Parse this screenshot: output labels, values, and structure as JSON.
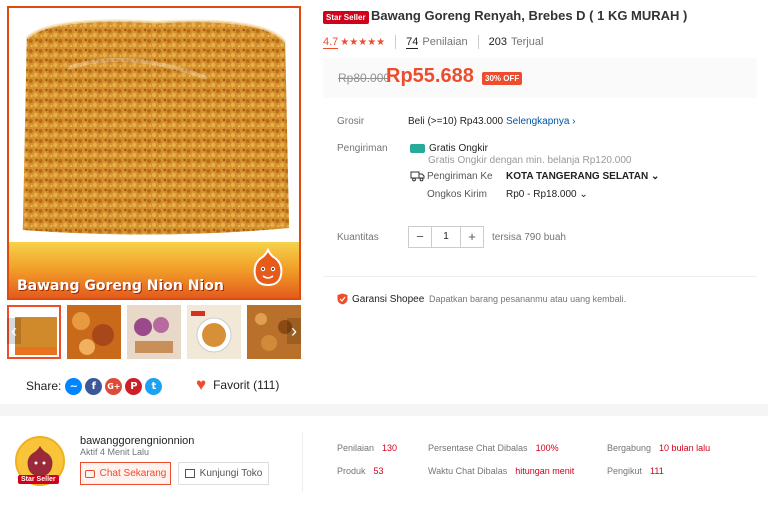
{
  "product": {
    "star_badge": "Star Seller",
    "title": "Bawang Goreng Renyah, Brebes D ( 1 KG MURAH )",
    "image_banner": "Bawang Goreng Nion Nion",
    "rating": "4.7",
    "stars": "★★★★★",
    "reviews_count": "74",
    "reviews_label": "Penilaian",
    "sold_count": "203",
    "sold_label": "Terjual",
    "old_price": "Rp80.000",
    "price": "Rp55.688",
    "discount": "30% OFF"
  },
  "details": {
    "grosir_label": "Grosir",
    "grosir_value": "Beli (>=10) Rp43.000",
    "grosir_link": "Selengkapnya ›",
    "shipping_label": "Pengiriman",
    "free_shipping": "Gratis Ongkir",
    "free_shipping_note": "Gratis Ongkir dengan min. belanja Rp120.000",
    "ship_to_label": "Pengiriman Ke",
    "ship_to_value": "KOTA TANGERANG SELATAN ⌄",
    "cost_label": "Ongkos Kirim",
    "cost_value": "Rp0 - Rp18.000 ⌄",
    "qty_label": "Kuantitas",
    "qty_minus": "−",
    "qty_value": "1",
    "qty_plus": "+",
    "stock": "tersisa 790 buah",
    "guarantee_title": "Garansi Shopee",
    "guarantee_desc": "Dapatkan barang pesananmu atau uang kembali."
  },
  "social": {
    "share_label": "Share:",
    "favorite_label": "Favorit (111)",
    "icons": [
      "messenger-icon",
      "facebook-icon",
      "google-plus-icon",
      "pinterest-icon",
      "twitter-icon"
    ]
  },
  "seller": {
    "name": "bawanggorengnionnion",
    "active": "Aktif 4 Menit Lalu",
    "badge": "Star Seller",
    "chat_button": "Chat Sekarang",
    "shop_button": "Kunjungi Toko",
    "stats": [
      {
        "label": "Penilaian",
        "value": "130"
      },
      {
        "label": "Produk",
        "value": "53"
      },
      {
        "label": "Persentase Chat Dibalas",
        "value": "100%"
      },
      {
        "label": "Waktu Chat Dibalas",
        "value": "hitungan menit"
      },
      {
        "label": "Bergabung",
        "value": "10 bulan lalu"
      },
      {
        "label": "Pengikut",
        "value": "111"
      }
    ]
  },
  "colors": {
    "accent": "#ee4d2d",
    "link": "#0055aa",
    "free_shipping": "#26aa99"
  }
}
